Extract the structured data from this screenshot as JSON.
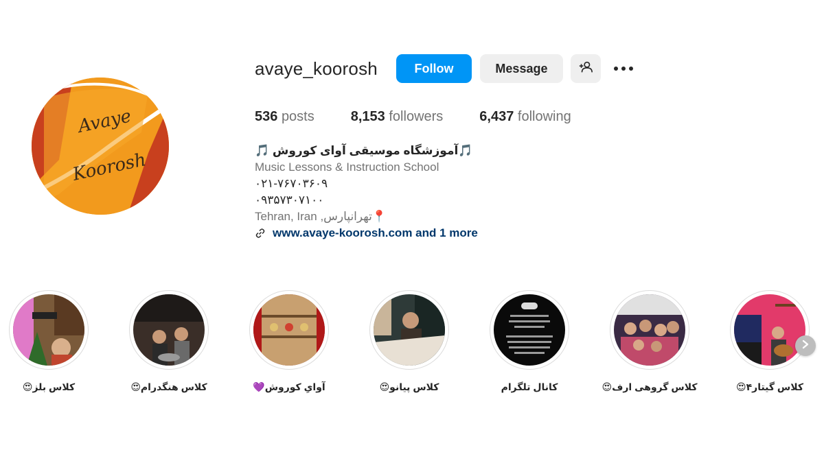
{
  "profile": {
    "username": "avaye_koorosh",
    "avatar_text_1": "Avaye",
    "avatar_text_2": "Koorosh",
    "follow_label": "Follow",
    "message_label": "Message",
    "add_user_icon": "add-user-icon",
    "more_icon": "more-options-icon"
  },
  "stats": {
    "posts_count": "536",
    "posts_label": "posts",
    "followers_count": "8,153",
    "followers_label": "followers",
    "following_count": "6,437",
    "following_label": "following"
  },
  "bio": {
    "name": "🎵آموزشگاه موسیقی آوای کوروش 🎵",
    "category": "Music Lessons & Instruction School",
    "phone_1": "۰۲۱-۷۶۷۰۳۶۰۹",
    "phone_2": "۰۹۳۵۷۳۰۷۱۰۰",
    "location": "Tehran, Iran ,تهرانپارس📍",
    "link": "www.avaye-koorosh.com and 1 more"
  },
  "highlights": [
    {
      "label": "کلاس بلز😍"
    },
    {
      "label": "کلاس هنگدرام😍"
    },
    {
      "label": "آوایِ کوروش💜"
    },
    {
      "label": "کلاس پیانو😍"
    },
    {
      "label": "کانال تلگرام"
    },
    {
      "label": "کلاس گروهی ارف😍"
    },
    {
      "label": "کلاس گیتار۴😍"
    }
  ],
  "colors": {
    "follow_blue": "#0095f6",
    "button_gray": "#efefef",
    "link_blue": "#00376b",
    "secondary_text": "#737373",
    "avatar_orange": "#f39c1e"
  }
}
